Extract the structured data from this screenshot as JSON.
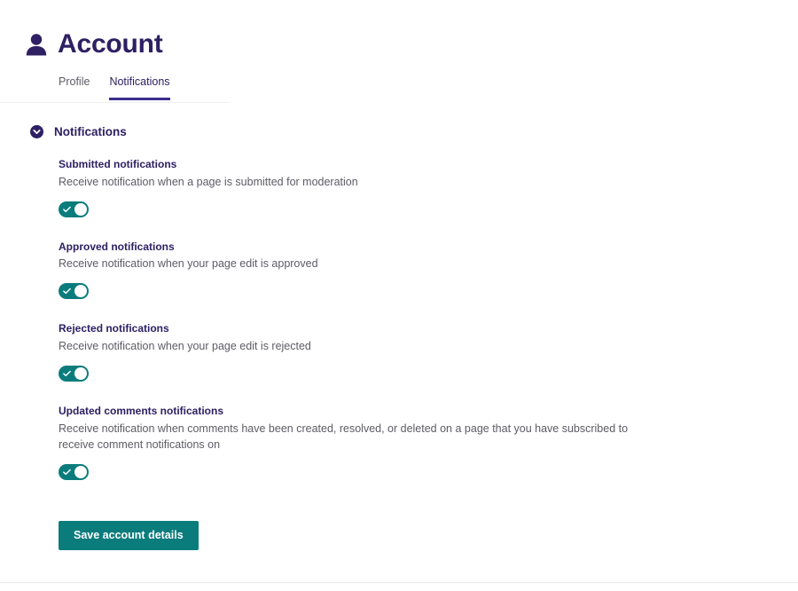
{
  "header": {
    "title": "Account",
    "icon": "user-icon"
  },
  "tabs": [
    {
      "label": "Profile",
      "active": false
    },
    {
      "label": "Notifications",
      "active": true
    }
  ],
  "section": {
    "title": "Notifications",
    "toggle_icon": "chevron-down-circle-icon",
    "expanded": true
  },
  "settings": [
    {
      "label": "Submitted notifications",
      "description": "Receive notification when a page is submitted for moderation",
      "toggle_on": true
    },
    {
      "label": "Approved notifications",
      "description": "Receive notification when your page edit is approved",
      "toggle_on": true
    },
    {
      "label": "Rejected notifications",
      "description": "Receive notification when your page edit is rejected",
      "toggle_on": true
    },
    {
      "label": "Updated comments notifications",
      "description": "Receive notification when comments have been created, resolved, or deleted on a page that you have subscribed to receive comment notifications on",
      "toggle_on": true
    }
  ],
  "actions": {
    "save_label": "Save account details"
  },
  "colors": {
    "brand_purple": "#2E2063",
    "tab_underline": "#3B2E8C",
    "accent_teal": "#0B7C7C",
    "muted_text": "#5C5C66",
    "divider": "#EFEFF1"
  }
}
